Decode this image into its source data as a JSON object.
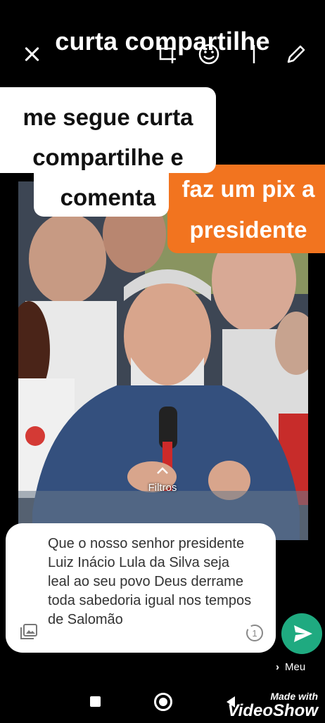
{
  "headline": "curta compartilhe",
  "white_sticker": {
    "line1": "me segue curta",
    "line2": "compartilhe e",
    "line3": "comenta"
  },
  "orange_sticker": {
    "line1": "faz um pix a",
    "line2": "presidente"
  },
  "filters_label": "Filtros",
  "caption": {
    "text": "Que o nosso senhor presidente Luiz Inácio Lula da Silva seja leal ao seu povo Deus derrame toda sabedoria igual nos tempos de Salomão",
    "view_once_label": "1"
  },
  "recipient": {
    "label": "Meu"
  },
  "watermark": {
    "small": "Made with",
    "big": "VideoShow"
  },
  "icons": [
    "close-icon",
    "crop-icon",
    "emoji-icon",
    "text-icon",
    "pen-icon",
    "chevron-up-icon",
    "gallery-icon",
    "view-once-icon",
    "send-icon",
    "chevron-right-icon",
    "recents-icon",
    "home-icon",
    "back-icon"
  ],
  "colors": {
    "orange_sticker": "#f2741f",
    "send_button": "#1faa80"
  }
}
